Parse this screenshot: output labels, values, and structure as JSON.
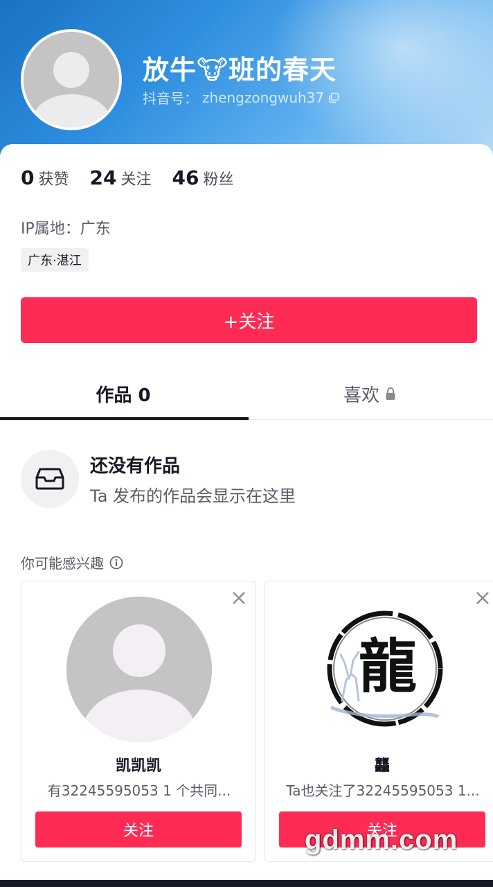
{
  "profile": {
    "name": "放牛🐮班的春天",
    "id_label": "抖音号：",
    "id_value": "zhengzongwuh37"
  },
  "stats": [
    {
      "value": "0",
      "label": "获赞"
    },
    {
      "value": "24",
      "label": "关注"
    },
    {
      "value": "46",
      "label": "粉丝"
    }
  ],
  "ip_location": "IP属地：广东",
  "location_tag": "广东·湛江",
  "follow_button": "+关注",
  "tabs": {
    "works": "作品 0",
    "likes": "喜欢"
  },
  "empty_state": {
    "title": "还没有作品",
    "description": "Ta 发布的作品会显示在这里"
  },
  "suggestions": {
    "title": "你可能感兴趣",
    "cards": [
      {
        "name": "凯凯凯",
        "description": "有32245595053 1 个共同...",
        "button": "关注"
      },
      {
        "name": "龘",
        "description": "Ta也关注了32245595053 1...",
        "button": "关注",
        "avatar_text": "龍"
      }
    ]
  },
  "watermark": "gdmm.com",
  "colors": {
    "accent": "#fe2c55",
    "header_blue": "#2f8fe0",
    "text_primary": "#161823",
    "text_secondary": "#5a5d68"
  }
}
